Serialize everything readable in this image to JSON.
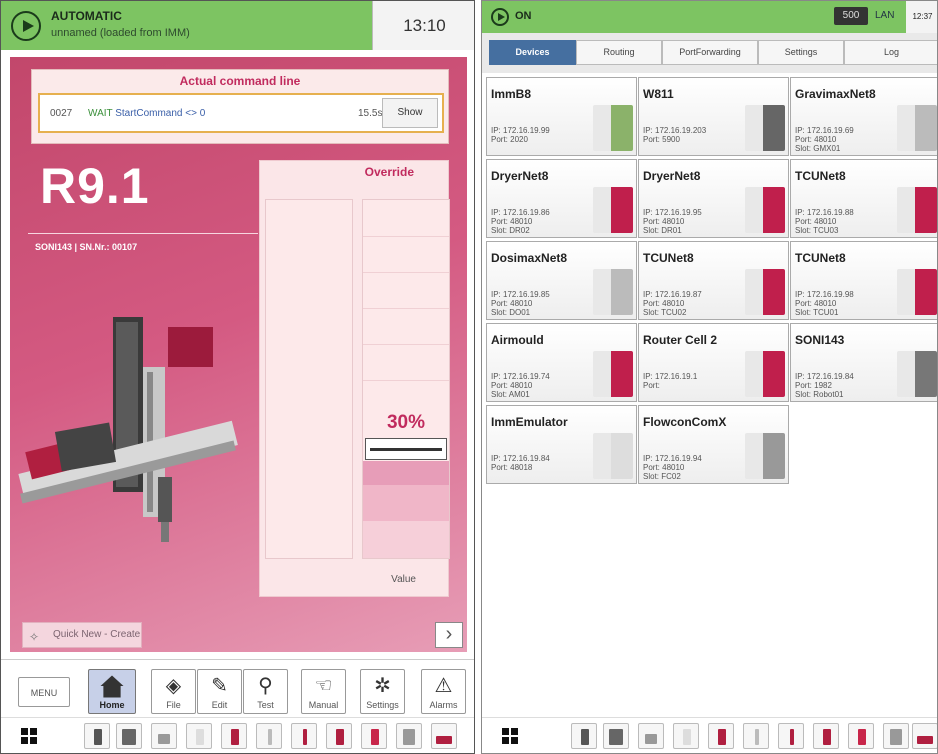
{
  "left": {
    "status": {
      "mode": "AUTOMATIC",
      "program": "unnamed (loaded from IMM)",
      "clock": "13:10",
      "color": "#7dc462"
    },
    "command": {
      "title": "Actual command line",
      "line_number": "0027",
      "keyword": "WAIT",
      "expression": "StartCommand <> 0",
      "duration": "15.5s",
      "show_label": "Show"
    },
    "robot": {
      "model": "R9.1",
      "serial": "SONI143 | SN.Nr.: 00107"
    },
    "override": {
      "title": "Override",
      "percent_label": "30%",
      "level": 0.3,
      "value_label": "Value"
    },
    "quick_new": "Quick New - Create",
    "nav": [
      {
        "label": "MENU",
        "icon": ""
      },
      {
        "label": "Home",
        "icon": "home-icon"
      },
      {
        "label": "File",
        "icon": "file-icon"
      },
      {
        "label": "Edit",
        "icon": "edit-icon"
      },
      {
        "label": "Test",
        "icon": "test-icon"
      },
      {
        "label": "Manual",
        "icon": "hand-icon"
      },
      {
        "label": "Settings",
        "icon": "settings-icon"
      },
      {
        "label": "Alarms",
        "icon": "alarm-icon"
      }
    ]
  },
  "right": {
    "status": {
      "state": "ON",
      "counter": "500",
      "network": "LAN",
      "clock": "12:37"
    },
    "tabs": [
      "Devices",
      "Routing",
      "PortForwarding",
      "Settings",
      "Log"
    ],
    "active_tab": "Devices",
    "devices": [
      {
        "name": "ImmB8",
        "info": [
          "IP: 172.16.19.99",
          "Port: 2020"
        ]
      },
      {
        "name": "W811",
        "info": [
          "IP: 172.16.19.203",
          "Port: 5900"
        ]
      },
      {
        "name": "GravimaxNet8",
        "info": [
          "IP: 172.16.19.69",
          "Port: 48010",
          "Slot: GMX01"
        ]
      },
      {
        "name": "DryerNet8",
        "info": [
          "IP: 172.16.19.86",
          "Port: 48010",
          "Slot: DR02"
        ]
      },
      {
        "name": "DryerNet8",
        "info": [
          "IP: 172.16.19.95",
          "Port: 48010",
          "Slot: DR01"
        ]
      },
      {
        "name": "TCUNet8",
        "info": [
          "IP: 172.16.19.88",
          "Port: 48010",
          "Slot: TCU03"
        ]
      },
      {
        "name": "DosimaxNet8",
        "info": [
          "IP: 172.16.19.85",
          "Port: 48010",
          "Slot: DO01"
        ]
      },
      {
        "name": "TCUNet8",
        "info": [
          "IP: 172.16.19.87",
          "Port: 48010",
          "Slot: TCU02"
        ]
      },
      {
        "name": "TCUNet8",
        "info": [
          "IP: 172.16.19.98",
          "Port: 48010",
          "Slot: TCU01"
        ]
      },
      {
        "name": "Airmould",
        "info": [
          "IP: 172.16.19.74",
          "Port: 48010",
          "Slot: AM01"
        ]
      },
      {
        "name": "Router Cell 2",
        "info": [
          "IP: 172.16.19.1",
          "Port:"
        ]
      },
      {
        "name": "SONI143",
        "info": [
          "IP: 172.16.19.84",
          "Port: 1982",
          "Slot: Robot01"
        ]
      },
      {
        "name": "ImmEmulator",
        "info": [
          "IP: 172.16.19.84",
          "Port: 48018"
        ]
      },
      {
        "name": "FlowconComX",
        "info": [
          "IP: 172.16.19.94",
          "Port: 48010",
          "Slot: FC02"
        ]
      }
    ]
  },
  "taskbar_icons": [
    "windows-start-icon",
    "device-icon",
    "tablet-icon",
    "gravimax-icon",
    "hand-icon",
    "dryer-icon",
    "tcu-icon",
    "antenna-icon",
    "tcu-icon",
    "dosimax-icon",
    "router-icon"
  ],
  "colors": {
    "accent": "#c12b5e",
    "tab_active": "#456fa0",
    "status_green": "#7dc462"
  }
}
